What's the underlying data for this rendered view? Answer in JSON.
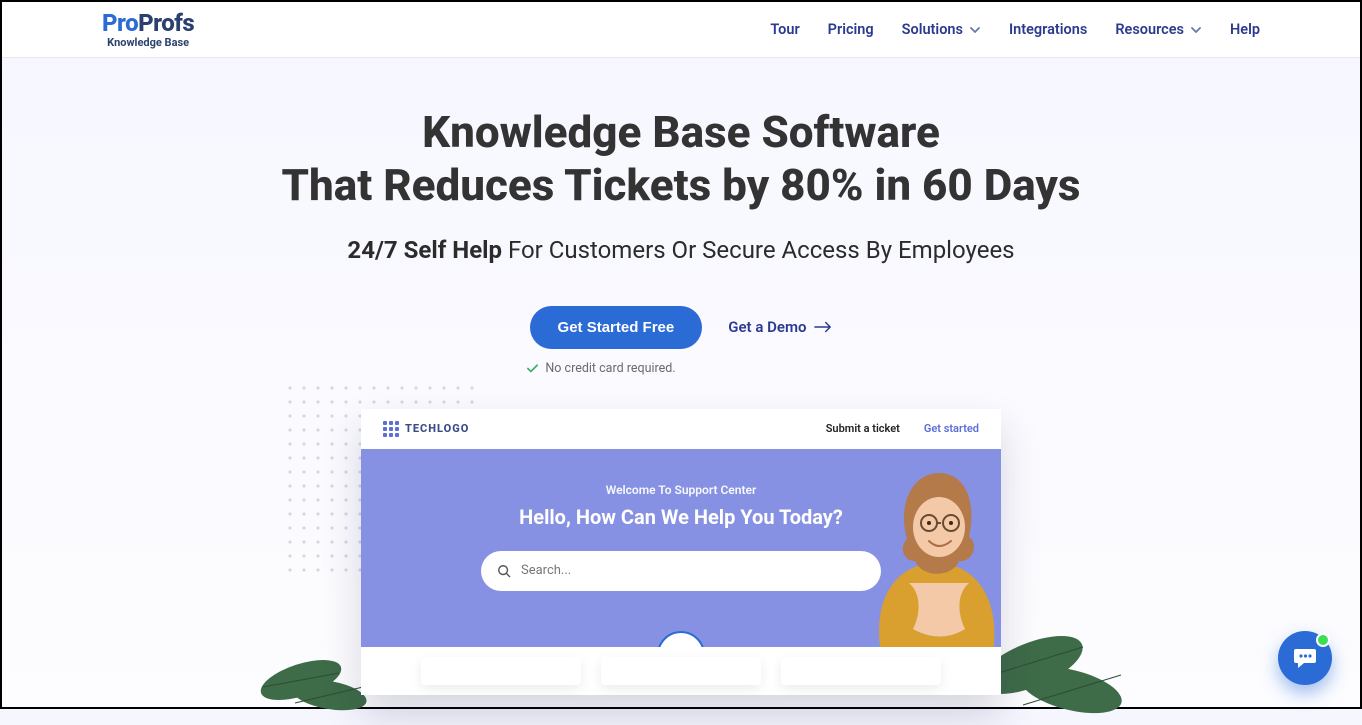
{
  "logo": {
    "part1": "Pro",
    "part2": "Profs",
    "subtitle": "Knowledge Base"
  },
  "nav": {
    "tour": "Tour",
    "pricing": "Pricing",
    "solutions": "Solutions",
    "integrations": "Integrations",
    "resources": "Resources",
    "help": "Help"
  },
  "hero": {
    "title_line1": "Knowledge Base Software",
    "title_line2": "That Reduces Tickets by 80% in 60 Days",
    "subtitle_bold": "24/7 Self Help",
    "subtitle_rest": " For Customers Or Secure Access By Employees",
    "cta_primary": "Get Started Free",
    "cta_demo": "Get a Demo",
    "cta_note": "No credit card required."
  },
  "preview": {
    "brand": "TECHLOGO",
    "link_submit": "Submit a ticket",
    "link_getstarted": "Get started",
    "welcome": "Welcome To Support Center",
    "hello": "Hello, How Can We Help You Today?",
    "search_placeholder": "Search..."
  }
}
